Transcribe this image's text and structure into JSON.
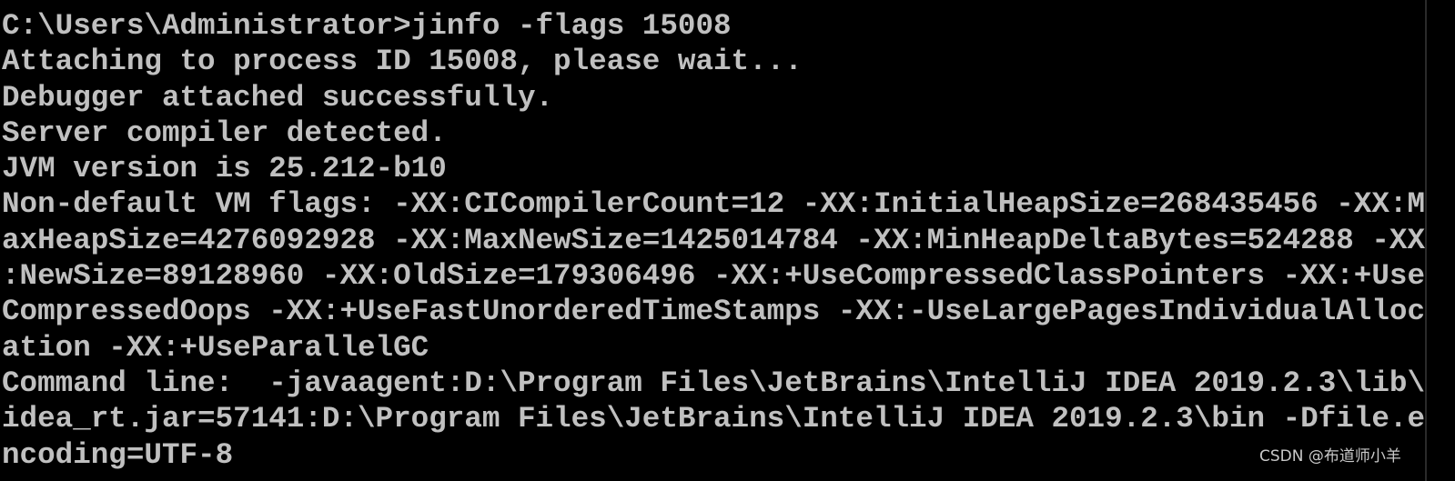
{
  "terminal": {
    "lines": [
      "C:\\Users\\Administrator>jinfo -flags 15008",
      "Attaching to process ID 15008, please wait...",
      "Debugger attached successfully.",
      "Server compiler detected.",
      "JVM version is 25.212-b10",
      "Non-default VM flags: -XX:CICompilerCount=12 -XX:InitialHeapSize=268435456 -XX:M",
      "axHeapSize=4276092928 -XX:MaxNewSize=1425014784 -XX:MinHeapDeltaBytes=524288 -XX",
      ":NewSize=89128960 -XX:OldSize=179306496 -XX:+UseCompressedClassPointers -XX:+Use",
      "CompressedOops -XX:+UseFastUnorderedTimeStamps -XX:-UseLargePagesIndividualAlloc",
      "ation -XX:+UseParallelGC",
      "Command line:  -javaagent:D:\\Program Files\\JetBrains\\IntelliJ IDEA 2019.2.3\\lib\\",
      "idea_rt.jar=57141:D:\\Program Files\\JetBrains\\IntelliJ IDEA 2019.2.3\\bin -Dfile.e",
      "ncoding=UTF-8"
    ],
    "text_color": "#c0c0c0",
    "background": "#000000"
  },
  "watermark": "CSDN @布道师小羊"
}
